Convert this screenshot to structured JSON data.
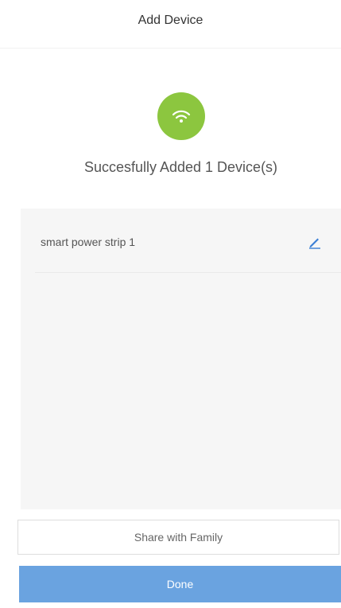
{
  "header": {
    "title": "Add Device"
  },
  "status": {
    "icon": "wifi-icon",
    "icon_color": "#8cc63f",
    "message": "Succesfully Added 1 Device(s)"
  },
  "devices": [
    {
      "name": "smart power strip 1",
      "action_icon": "edit-pencil-icon"
    }
  ],
  "actions": {
    "share_label": "Share with Family",
    "done_label": "Done",
    "done_color": "#6aa3e0"
  }
}
